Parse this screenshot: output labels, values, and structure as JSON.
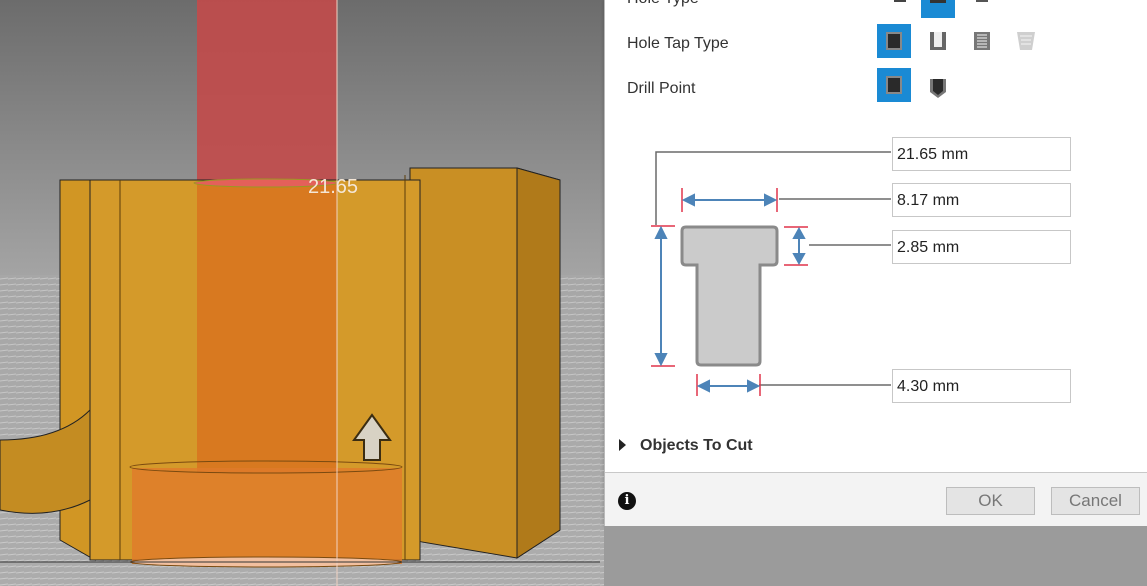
{
  "viewport": {
    "dimension_readout": "21.65"
  },
  "panel": {
    "hole_type_label": "Hole Type",
    "hole_tap_type_label": "Hole Tap Type",
    "drill_point_label": "Drill Point",
    "hole_tap_type_options": [
      "simple-tap-icon",
      "clearance-tap-icon",
      "tapped-icon",
      "taper-tapped-icon"
    ],
    "hole_tap_type_selected": "simple-tap-icon",
    "drill_point_options": [
      "flat-drill-point-icon",
      "angled-drill-point-icon"
    ],
    "drill_point_selected": "flat-drill-point-icon",
    "dimensions": {
      "depth": "21.65 mm",
      "counterbore_diameter": "8.17 mm",
      "counterbore_depth": "2.85 mm",
      "diameter": "4.30 mm"
    },
    "objects_to_cut_label": "Objects To Cut",
    "ok_label": "OK",
    "cancel_label": "Cancel",
    "accent_color": "#1a8ad4"
  }
}
